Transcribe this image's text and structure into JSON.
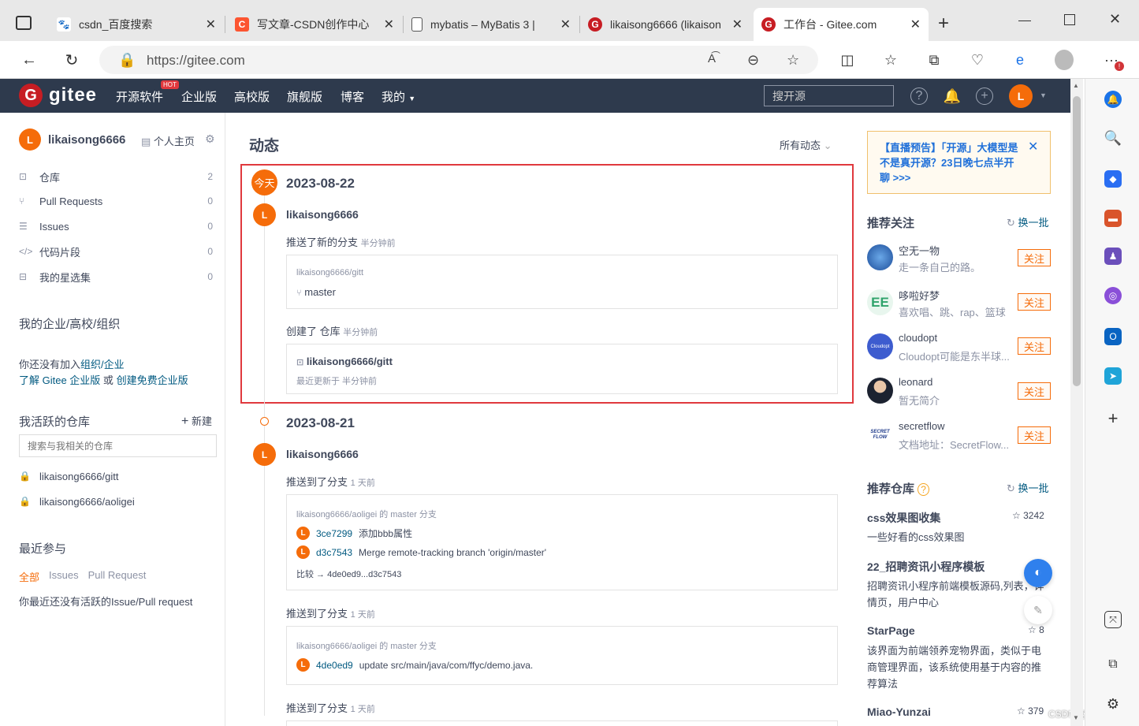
{
  "browser": {
    "tabs": [
      {
        "label": "csdn_百度搜索",
        "icon": "baidu-paw-icon",
        "color": "#2932e1"
      },
      {
        "label": "写文章-CSDN创作中心",
        "icon": "csdn-c-icon",
        "color": "#fc5531"
      },
      {
        "label": "mybatis – MyBatis 3 | ",
        "icon": "document-icon",
        "color": "#555555"
      },
      {
        "label": "likaisong6666 (likaison",
        "icon": "gitee-g-icon",
        "color": "#c71d23"
      },
      {
        "label": "工作台 - Gitee.com",
        "icon": "gitee-g-icon",
        "color": "#c71d23"
      }
    ],
    "url": "https://gitee.com"
  },
  "gitee": {
    "logo": "gitee",
    "nav": [
      "开源软件",
      "企业版",
      "高校版",
      "旗舰版",
      "博客",
      "我的"
    ],
    "hot_badge": "HOT",
    "search_placeholder": "搜开源",
    "avatar_letter": "L",
    "brand_color": "#c71d23",
    "accent_color": "#f56c0a"
  },
  "sidebar": {
    "username": "likaisong6666",
    "profile_link": "个人主页",
    "items": [
      {
        "label": "仓库",
        "count": "2",
        "icon": "repo-icon"
      },
      {
        "label": "Pull Requests",
        "count": "0",
        "icon": "pull-request-icon"
      },
      {
        "label": "Issues",
        "count": "0",
        "icon": "issues-icon"
      },
      {
        "label": "代码片段",
        "count": "0",
        "icon": "code-icon"
      },
      {
        "label": "我的星选集",
        "count": "0",
        "icon": "star-collection-icon"
      }
    ],
    "org_heading": "我的企业/高校/组织",
    "org_text1": "你还没有加入",
    "org_link1": "组织/企业",
    "org_link2": "了解 Gitee 企业版",
    "org_or": "或",
    "org_link3": "创建免费企业版",
    "active_heading": "我活跃的仓库",
    "new_label": "新建",
    "repo_search_placeholder": "搜索与我相关的仓库",
    "repos": [
      "likaisong6666/gitt",
      "likaisong6666/aoligei"
    ],
    "recent_heading": "最近参与",
    "recent_tabs": [
      "全部",
      "Issues",
      "Pull Request"
    ],
    "recent_empty": "你最近还没有活跃的Issue/Pull request"
  },
  "feed": {
    "title": "动态",
    "filter": "所有动态",
    "today_badge": "今天",
    "days": [
      {
        "date": "2023-08-22",
        "user": "likaisong6666",
        "events": [
          {
            "action": "推送了新的分支",
            "time": "半分钟前",
            "repo": "likaisong6666/gitt",
            "branch": "master"
          },
          {
            "action": "创建了 仓库",
            "time": "半分钟前",
            "repo": "likaisong6666/gitt",
            "updated": "最近更新于 半分钟前"
          }
        ]
      },
      {
        "date": "2023-08-21",
        "user": "likaisong6666",
        "events": [
          {
            "action": "推送到了分支",
            "time": "1 天前",
            "branch_line": "likaisong6666/aoligei 的 master 分支",
            "commits": [
              {
                "hash": "3ce7299",
                "msg": "添加bbb属性"
              },
              {
                "hash": "d3c7543",
                "msg": "Merge remote-tracking branch 'origin/master'"
              }
            ],
            "compare": "比较 → 4de0ed9...d3c7543"
          },
          {
            "action": "推送到了分支",
            "time": "1 天前",
            "branch_line": "likaisong6666/aoligei 的 master 分支",
            "commits": [
              {
                "hash": "4de0ed9",
                "msg": "update src/main/java/com/ffyc/demo.java."
              }
            ]
          },
          {
            "action": "推送到了分支",
            "time": "1 天前"
          }
        ]
      }
    ]
  },
  "right": {
    "notice": "【直播预告】「开源」大模型是不是真开源？23日晚七点半开聊 >>>",
    "rec_follow_heading": "推荐关注",
    "refresh_label": "换一批",
    "follow_label": "关注",
    "users": [
      {
        "name": "空无一物",
        "desc": "走一条自己的路。"
      },
      {
        "name": "哆啦好梦",
        "desc": "喜欢唱、跳、rap、篮球"
      },
      {
        "name": "cloudopt",
        "desc": "Cloudopt可能是东半球..."
      },
      {
        "name": "leonard",
        "desc": "暂无简介"
      },
      {
        "name": "secretflow",
        "desc": "文档地址：SecretFlow..."
      }
    ],
    "cloudopt_avatar_text": "Cloudopt",
    "secretflow_avatar_text": "SECRET FLOW",
    "rec_repo_heading": "推荐仓库",
    "repos": [
      {
        "name": "css效果图收集",
        "stars": "3242",
        "desc": "一些好看的css效果图"
      },
      {
        "name": "22_招聘资讯小程序模板",
        "stars": "",
        "desc": "招聘资讯小程序前端模板源码,列表，详情页，用户中心"
      },
      {
        "name": "StarPage",
        "stars": "8",
        "desc": "该界面为前端领养宠物界面，类似于电商管理界面，该系统使用基于内容的推荐算法"
      },
      {
        "name": "Miao-Yunzai",
        "stars": "379",
        "desc": ""
      }
    ]
  },
  "watermark": "CSDN @帝锦_li"
}
